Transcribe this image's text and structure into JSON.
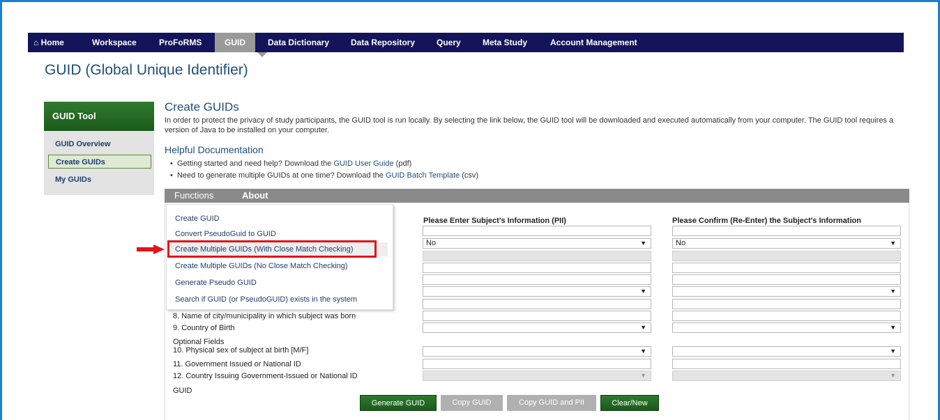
{
  "nav": {
    "items": [
      {
        "label": "Home",
        "icon": "home-icon",
        "active": false
      },
      {
        "label": "Workspace",
        "active": false
      },
      {
        "label": "ProFoRMS",
        "active": false
      },
      {
        "label": "GUID",
        "active": true
      },
      {
        "label": "Data Dictionary",
        "active": false
      },
      {
        "label": "Data Repository",
        "active": false
      },
      {
        "label": "Query",
        "active": false
      },
      {
        "label": "Meta Study",
        "active": false
      },
      {
        "label": "Account Management",
        "active": false
      }
    ]
  },
  "page_title": "GUID (Global Unique Identifier)",
  "sidebar": {
    "title": "GUID Tool",
    "items": [
      {
        "label": "GUID Overview",
        "active": false
      },
      {
        "label": "Create GUIDs",
        "active": true
      },
      {
        "label": "My GUIDs",
        "active": false
      }
    ]
  },
  "main": {
    "heading": "Create GUIDs",
    "intro": "In order to protect the privacy of study participants, the GUID tool is run locally. By selecting the link below, the GUID tool will be downloaded and executed automatically from your computer. The GUID tool requires a version of Java to be installed on your computer.",
    "help_heading": "Helpful Documentation",
    "docs": [
      {
        "prefix": "Getting started and need help? Download the ",
        "link": "GUID User Guide",
        "suffix": " (pdf)"
      },
      {
        "prefix": "Need to generate multiple GUIDs at one time? Download the ",
        "link": "GUID Batch Template",
        "suffix": " (csv)"
      }
    ]
  },
  "panel": {
    "tabs": [
      "Functions",
      "About"
    ],
    "menu": [
      "Create GUID",
      "Convert PseudoGuid to GUID",
      "Create Multiple GUIDs (With Close Match Checking)",
      "Create Multiple GUIDs (No Close Match Checking)",
      "Generate Pseudo GUID",
      "Search if GUID (or PseudoGUID) exists in the system"
    ],
    "highlighted_index": 2,
    "col1_heading": "Please Enter Subject's Information (PII)",
    "col2_heading": "Please Confirm (Re-Enter) the Subject's Information",
    "labels": [
      "8.  Name of city/municipality in which subject was born",
      "9.  Country of Birth",
      "Optional Fields",
      "10. Physical sex of subject at birth [M/F]",
      "11. Government Issued or National ID",
      "12. Country Issuing Government-Issued or National ID",
      "GUID"
    ],
    "select_value": "No",
    "select_arrow": "▼",
    "buttons": [
      "Generate GUID",
      "Copy GUID",
      "Copy GUID and PII",
      "Clear/New"
    ]
  },
  "colors": {
    "nav_bg": "#14145a",
    "accent_green": "#1b5a1b",
    "title_blue": "#1f4e7a",
    "annotation_red": "#e0141a",
    "frame_blue": "#1a7fd4"
  }
}
